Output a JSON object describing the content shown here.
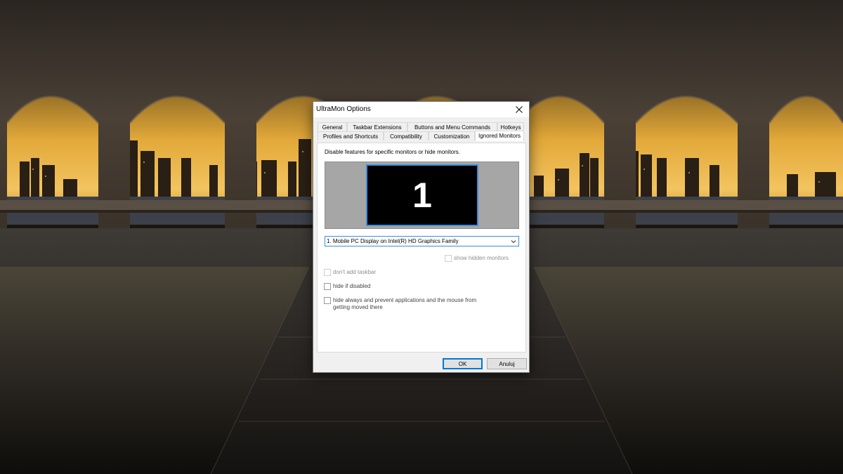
{
  "window": {
    "title": "UltraMon Options",
    "close_icon": "close-icon"
  },
  "tabs": {
    "row1": [
      "General",
      "Taskbar Extensions",
      "Buttons and Menu Commands",
      "Hotkeys"
    ],
    "row2": [
      "Profiles and Shortcuts",
      "Compatibility",
      "Customization",
      "Ignored Monitors"
    ],
    "active": "Ignored Monitors"
  },
  "panel": {
    "description": "Disable features for specific monitors or hide monitors.",
    "monitor_number": "1",
    "monitor_select": "1. Mobile PC Display on Intel(R) HD Graphics Family",
    "show_hidden_label": "show hidden monitors",
    "options": [
      {
        "label": "don't add taskbar",
        "checked": false,
        "enabled": false
      },
      {
        "label": "hide if disabled",
        "checked": false,
        "enabled": true
      },
      {
        "label": "hide always and prevent applications and the mouse from getting moved there",
        "checked": false,
        "enabled": true
      }
    ]
  },
  "buttons": {
    "ok": "OK",
    "cancel": "Anuluj"
  },
  "colors": {
    "accent": "#3c8dde",
    "dialog_bg": "#f0f0f0"
  }
}
